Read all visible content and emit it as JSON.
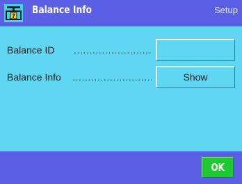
{
  "header": {
    "icon": "balance-info-icon",
    "title": "Balance Info",
    "mode": "Setup"
  },
  "rows": [
    {
      "label": "Balance ID",
      "dots": "...............................",
      "button_label": ""
    },
    {
      "label": "Balance Info",
      "dots": "..............................",
      "button_label": "Show"
    }
  ],
  "footer": {
    "ok_label": "OK"
  },
  "colors": {
    "header_bg": "#5b5fe6",
    "content_bg": "#5fd6f2",
    "ok_green": "#1ec932",
    "icon_bg": "#3fd3ee"
  }
}
